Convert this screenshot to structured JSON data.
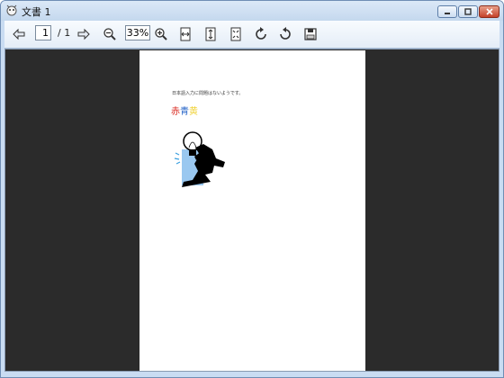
{
  "window": {
    "title": "文書 1"
  },
  "toolbar": {
    "page_current": "1",
    "page_total": "/ 1",
    "zoom": "33%"
  },
  "document": {
    "line1": "日本語入力に問題はないようです。",
    "color_words": [
      "赤",
      "青",
      "黄"
    ]
  },
  "colors": {
    "red": "#d8261c",
    "blue": "#2866c8",
    "yellow": "#f0d33a",
    "viewer_bg": "#2b2b2b"
  },
  "icons": [
    "app-icon",
    "prev-page-icon",
    "next-page-icon",
    "zoom-out-icon",
    "zoom-in-icon",
    "fit-width-icon",
    "fit-height-icon",
    "fit-page-icon",
    "rotate-cw-icon",
    "rotate-ccw-icon",
    "save-icon"
  ]
}
